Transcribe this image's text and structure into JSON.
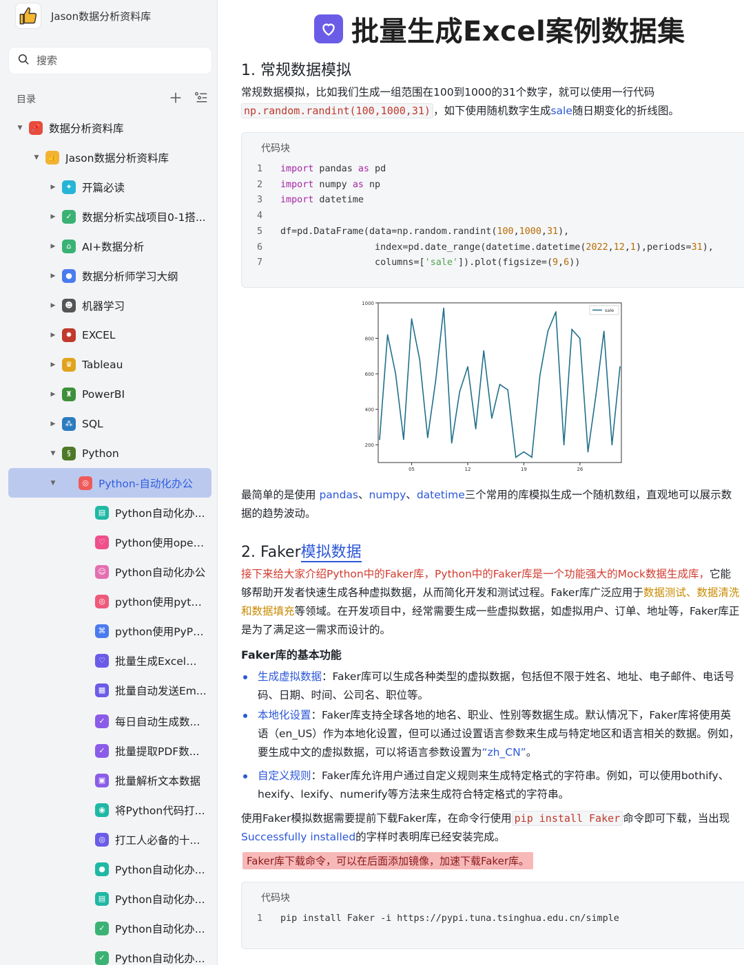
{
  "sidebar": {
    "brand": "Jason数据分析资料库",
    "search_placeholder": "搜索",
    "toc_title": "目录",
    "items": [
      {
        "label": "数据分析资料库",
        "level": 0,
        "caret": "down",
        "icon": "pin-icon",
        "color": "#e74c3c"
      },
      {
        "label": "Jason数据分析资料库",
        "level": 1,
        "caret": "down",
        "icon": "thumbs-up-icon",
        "color": "#f2b233"
      },
      {
        "label": "开篇必读",
        "level": 2,
        "caret": "right",
        "icon": "star-icon",
        "color": "#26b5d6"
      },
      {
        "label": "数据分析实战项目0-1搭...",
        "level": 2,
        "caret": "right",
        "icon": "check-icon",
        "color": "#3bb273"
      },
      {
        "label": "AI+数据分析",
        "level": 2,
        "caret": "right",
        "icon": "home-icon",
        "color": "#3bb273"
      },
      {
        "label": "数据分析师学习大纲",
        "level": 2,
        "caret": "right",
        "icon": "circle-icon",
        "color": "#4a7bef"
      },
      {
        "label": "机器学习",
        "level": 2,
        "caret": "right",
        "icon": "robot-icon",
        "color": "#555555"
      },
      {
        "label": "EXCEL",
        "level": 2,
        "caret": "right",
        "icon": "bug-icon",
        "color": "#c0392b"
      },
      {
        "label": "Tableau",
        "level": 2,
        "caret": "right",
        "icon": "crown-icon",
        "color": "#e0a31c"
      },
      {
        "label": "PowerBI",
        "level": 2,
        "caret": "right",
        "icon": "trophy-icon",
        "color": "#3f8f3a"
      },
      {
        "label": "SQL",
        "level": 2,
        "caret": "right",
        "icon": "molecule-icon",
        "color": "#2b7bbf"
      },
      {
        "label": "Python",
        "level": 2,
        "caret": "down",
        "icon": "python-icon",
        "color": "#4e7a28"
      },
      {
        "label": "Python-自动化办公",
        "level": 3,
        "caret": "down",
        "icon": "target-icon",
        "color": "#ef5a5a",
        "active": true
      },
      {
        "label": "Python自动化办...",
        "level": 4,
        "caret": "none",
        "icon": "doc-icon",
        "color": "#1fb8a5"
      },
      {
        "label": "Python使用open...",
        "level": 4,
        "caret": "none",
        "icon": "heart-icon",
        "color": "#ef4f8b"
      },
      {
        "label": "Python自动化办公",
        "level": 4,
        "caret": "none",
        "icon": "smile-icon",
        "color": "#e46fb0"
      },
      {
        "label": "python使用pytho...",
        "level": 4,
        "caret": "none",
        "icon": "target-icon",
        "color": "#ef5a7a"
      },
      {
        "label": "python使用PyPD...",
        "level": 4,
        "caret": "none",
        "icon": "gamepad-icon",
        "color": "#4a7bef"
      },
      {
        "label": "批量生成Excel案...",
        "level": 4,
        "caret": "none",
        "icon": "heart-icon",
        "color": "#6b5ce7"
      },
      {
        "label": "批量自动发送Em...",
        "level": 4,
        "caret": "none",
        "icon": "grid-icon",
        "color": "#6b5ce7"
      },
      {
        "label": "每日自动生成数...",
        "level": 4,
        "caret": "none",
        "icon": "check-icon",
        "color": "#8a5ce7"
      },
      {
        "label": "批量提取PDF数...",
        "level": 4,
        "caret": "none",
        "icon": "check-icon",
        "color": "#8a5ce7"
      },
      {
        "label": "批量解析文本数据",
        "level": 4,
        "caret": "none",
        "icon": "image-icon",
        "color": "#8a5ce7"
      },
      {
        "label": "将Python代码打...",
        "level": 4,
        "caret": "none",
        "icon": "dot-icon",
        "color": "#1fb8a5"
      },
      {
        "label": "打工人必备的十...",
        "level": 4,
        "caret": "none",
        "icon": "target-icon",
        "color": "#6b5ce7"
      },
      {
        "label": "Python自动化办...",
        "level": 4,
        "caret": "none",
        "icon": "circle-icon",
        "color": "#1fb8a5"
      },
      {
        "label": "Python自动化办...",
        "level": 4,
        "caret": "none",
        "icon": "doc-icon",
        "color": "#1fb8a5"
      },
      {
        "label": "Python自动化办...",
        "level": 4,
        "caret": "none",
        "icon": "check-icon",
        "color": "#3bb273"
      },
      {
        "label": "Python自动化办...",
        "level": 4,
        "caret": "none",
        "icon": "check-icon",
        "color": "#3bb273"
      }
    ]
  },
  "doc": {
    "title": "批量生成Excel案例数据集",
    "sec1": {
      "heading": "1. 常规数据模拟",
      "p1_a": "常规数据模拟，比如我们生成一组范围在100到1000的31个数字，就可以使用一行代码",
      "p1_code": "np.random.randint(100,1000,31)",
      "p1_b": "，如下使用随机数字生成",
      "p1_link": "sale",
      "p1_c": "随日期变化的折线图。",
      "code_label": "代码块",
      "p2_a": "最简单的是使用 ",
      "p2_l1": "pandas",
      "p2_sep1": "、",
      "p2_l2": "numpy",
      "p2_sep2": "、",
      "p2_l3": "datetime",
      "p2_b": "三个常用的库模拟生成一个随机数组，直观地可以展示数据的趋势波动。"
    },
    "sec2": {
      "heading_a": "2. Faker",
      "heading_link": "模拟数据",
      "p1_red": "接下来给大家介绍Python中的Faker库，Python中的Faker库是一个功能强大的Mock数据生成库，",
      "p1_b": "它能够帮助开发者快速生成各种虚拟数据，从而简化开发和测试过程。Faker库广泛应用于",
      "p1_orange": "数据测试、数据清洗和数据填充",
      "p1_c": "等领域。在开发项目中，经常需要生成一些虚拟数据，如虚拟用户、订单、地址等，Faker库正是为了满足这一需求而设计的。",
      "subhead": "Faker库的基本功能",
      "b1_link": "生成虚拟数据",
      "b1_text": "：Faker库可以生成各种类型的虚拟数据，包括但不限于姓名、地址、电子邮件、电话号码、日期、时间、公司名、职位等。",
      "b2_link": "本地化设置",
      "b2_text": "：Faker库支持全球各地的地名、职业、性别等数据生成。默认情况下，Faker库将使用英语（en_US）作为本地化设置，但可以通过设置语言参数来生成与特定地区和语言相关的数据。例如，要生成中文的虚拟数据，可以将语言参数设置为",
      "b2_quote": "“zh_CN”",
      "b2_end": "。",
      "b3_link": "自定义规则",
      "b3_text": "：Faker库允许用户通过自定义规则来生成特定格式的字符串。例如，可以使用bothify、hexify、lexify、numerify等方法来生成符合特定格式的字符串。",
      "p2_a": "使用Faker模拟数据需要提前下载Faker库，在命令行使用",
      "p2_code": "pip install Faker",
      "p2_b": "命令即可下载，当出现",
      "p2_link": "Successfully installed",
      "p2_c": "的字样时表明库已经安装完成。",
      "highlight": "Faker库下载命令，可以在后面添加镜像，加速下载Faker库。",
      "code_label": "代码块",
      "code_line": "pip install Faker -i https://pypi.tuna.tsinghua.edu.cn/simple"
    }
  },
  "chart_data": {
    "type": "line",
    "title": "",
    "xlabel": "",
    "ylabel": "",
    "x_ticks": [
      "05",
      "12",
      "19",
      "26"
    ],
    "y_ticks": [
      200,
      400,
      600,
      800,
      1000
    ],
    "ylim": [
      100,
      1000
    ],
    "legend": "top-right",
    "grid": false,
    "series": [
      {
        "name": "sale",
        "color": "#1f6f8b",
        "x": [
          "2022-12-01",
          "2022-12-02",
          "2022-12-03",
          "2022-12-04",
          "2022-12-05",
          "2022-12-06",
          "2022-12-07",
          "2022-12-08",
          "2022-12-09",
          "2022-12-10",
          "2022-12-11",
          "2022-12-12",
          "2022-12-13",
          "2022-12-14",
          "2022-12-15",
          "2022-12-16",
          "2022-12-17",
          "2022-12-18",
          "2022-12-19",
          "2022-12-20",
          "2022-12-21",
          "2022-12-22",
          "2022-12-23",
          "2022-12-24",
          "2022-12-25",
          "2022-12-26",
          "2022-12-27",
          "2022-12-28",
          "2022-12-29",
          "2022-12-30",
          "2022-12-31"
        ],
        "values": [
          230,
          820,
          600,
          230,
          910,
          680,
          240,
          560,
          970,
          210,
          500,
          640,
          290,
          730,
          350,
          540,
          510,
          130,
          160,
          130,
          590,
          840,
          950,
          200,
          850,
          800,
          160,
          480,
          840,
          200,
          640
        ]
      }
    ]
  }
}
